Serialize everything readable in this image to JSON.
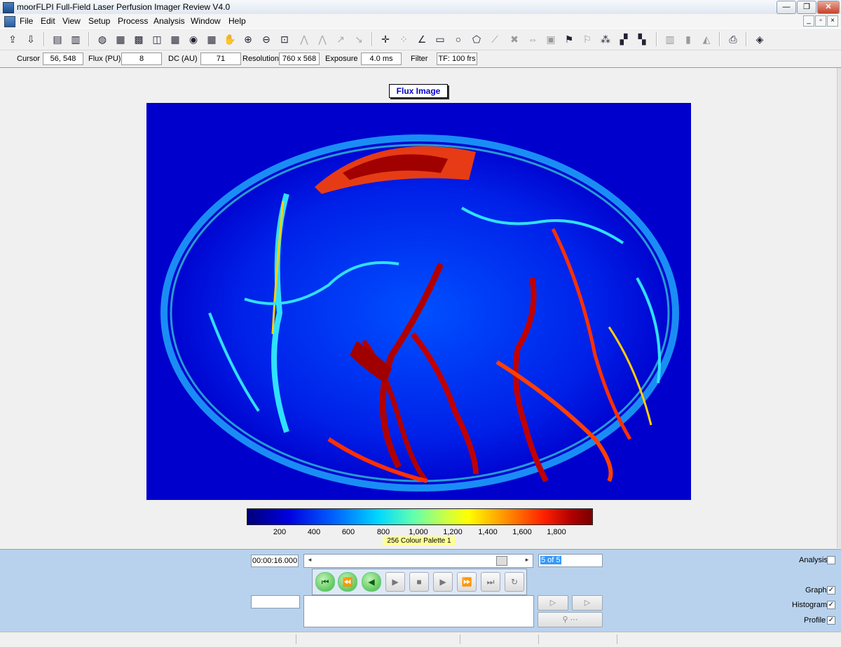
{
  "window": {
    "title": "moorFLPI Full-Field Laser Perfusion Imager Review V4.0",
    "min_label": "—",
    "max_label": "❐",
    "close_label": "✕"
  },
  "menu": [
    "File",
    "Edit",
    "View",
    "Setup",
    "Process",
    "Analysis",
    "Window",
    "Help"
  ],
  "status": {
    "cursor_label": "Cursor",
    "cursor_value": "56, 548",
    "flux_label": "Flux (PU)",
    "flux_value": "8",
    "dc_label": "DC (AU)",
    "dc_value": "71",
    "resolution_label": "Resolution",
    "resolution_value": "760 x 568",
    "exposure_label": "Exposure",
    "exposure_value": "4.0 ms",
    "filter_label": "Filter",
    "filter_value": "TF: 100 frs"
  },
  "image": {
    "title": "Flux Image"
  },
  "colorbar": {
    "ticks": [
      "200",
      "400",
      "600",
      "800",
      "1,000",
      "1,200",
      "1,400",
      "1,600",
      "1,800"
    ],
    "palette": "256 Colour Palette 1"
  },
  "playback": {
    "time": "00:00:16.000",
    "frame": "5 of 5",
    "position": 0.92
  },
  "options": {
    "analysis": "Analysis",
    "graph": "Graph",
    "histogram": "Histogram",
    "profile": "Profile",
    "check": "✓"
  },
  "colors": {
    "panel": "#b8d2ee",
    "image_bg": "#0000cc"
  }
}
